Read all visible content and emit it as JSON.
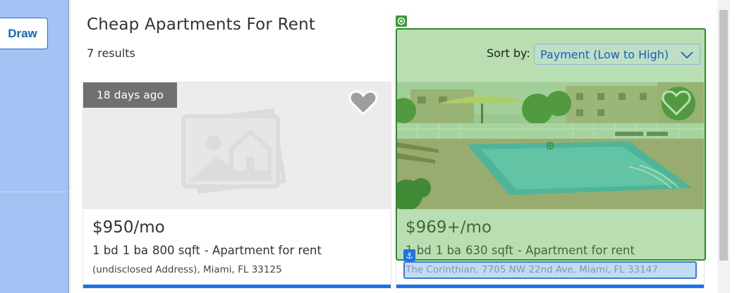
{
  "map": {
    "draw_label": "Draw"
  },
  "header": {
    "title": "Cheap Apartments For Rent",
    "results": "7 results"
  },
  "sort": {
    "label": "Sort by:",
    "selected": "Payment (Low to High)"
  },
  "listings": [
    {
      "age": "18 days ago",
      "price": "$950/mo",
      "beds": "1 bd",
      "baths": "1 ba",
      "sqft": "800 sqft",
      "type": "- Apartment for rent",
      "address": "(undisclosed Address), Miami, FL 33125",
      "photo": "placeholder-photo-icon"
    },
    {
      "price": "$969+/mo",
      "beds": "1 bd",
      "baths": "1 ba",
      "sqft": "630 sqft",
      "type": "- Apartment for rent",
      "address": "The Corinthian, 7705 NW 22nd Ave, Miami, FL 33147",
      "photo": "pool-photo"
    }
  ],
  "colors": {
    "accent": "#1a73e8",
    "badge_bg": "#707070",
    "highlight_green": "#2e8b2e"
  }
}
